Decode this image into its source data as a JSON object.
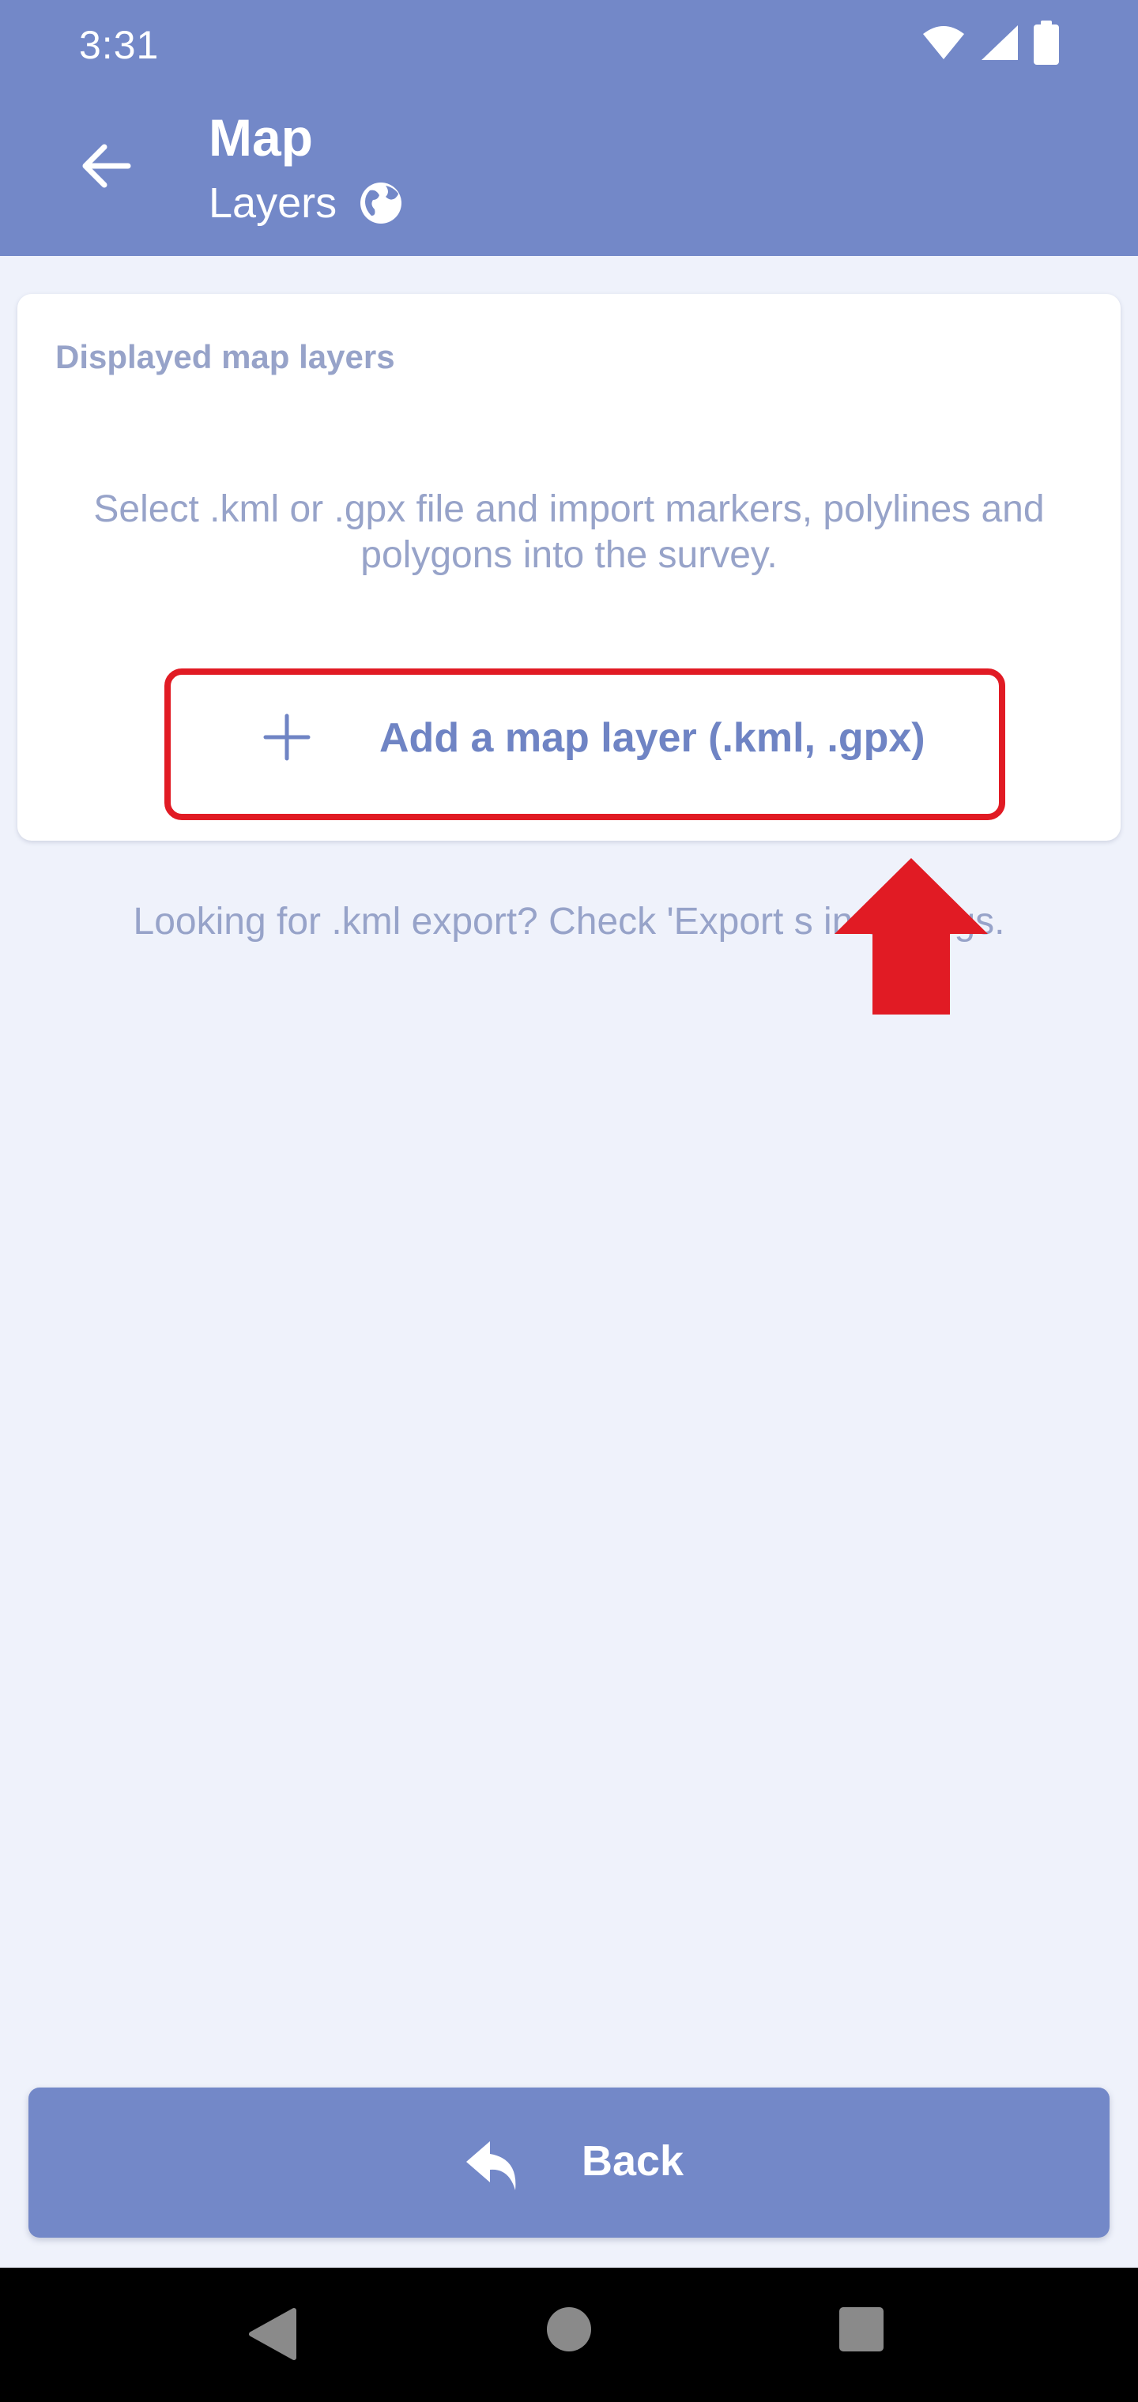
{
  "status_bar": {
    "time": "3:31",
    "icons": [
      "wifi-icon",
      "signal-icon",
      "battery-icon"
    ]
  },
  "app_bar": {
    "title": "Map",
    "subtitle": "Layers",
    "back_icon": "arrow-left-icon",
    "subtitle_icon": "globe-icon"
  },
  "card": {
    "title": "Displayed map layers",
    "description": "Select .kml or .gpx file and import markers, polylines and polygons into the survey.",
    "add_button_label": "Add a map layer (.kml, .gpx)",
    "add_button_icon": "plus-icon"
  },
  "export_hint": "Looking for .kml export? Check 'Export s in settings.",
  "back_button": {
    "label": "Back",
    "icon": "reply-icon"
  },
  "colors": {
    "primary": "#7388c8",
    "background": "#eff2fb",
    "muted_text": "#97a3c9",
    "annotation_red": "#e11b24"
  },
  "annotation": {
    "type": "highlight-box-and-arrow",
    "target": "add-layer-button"
  }
}
